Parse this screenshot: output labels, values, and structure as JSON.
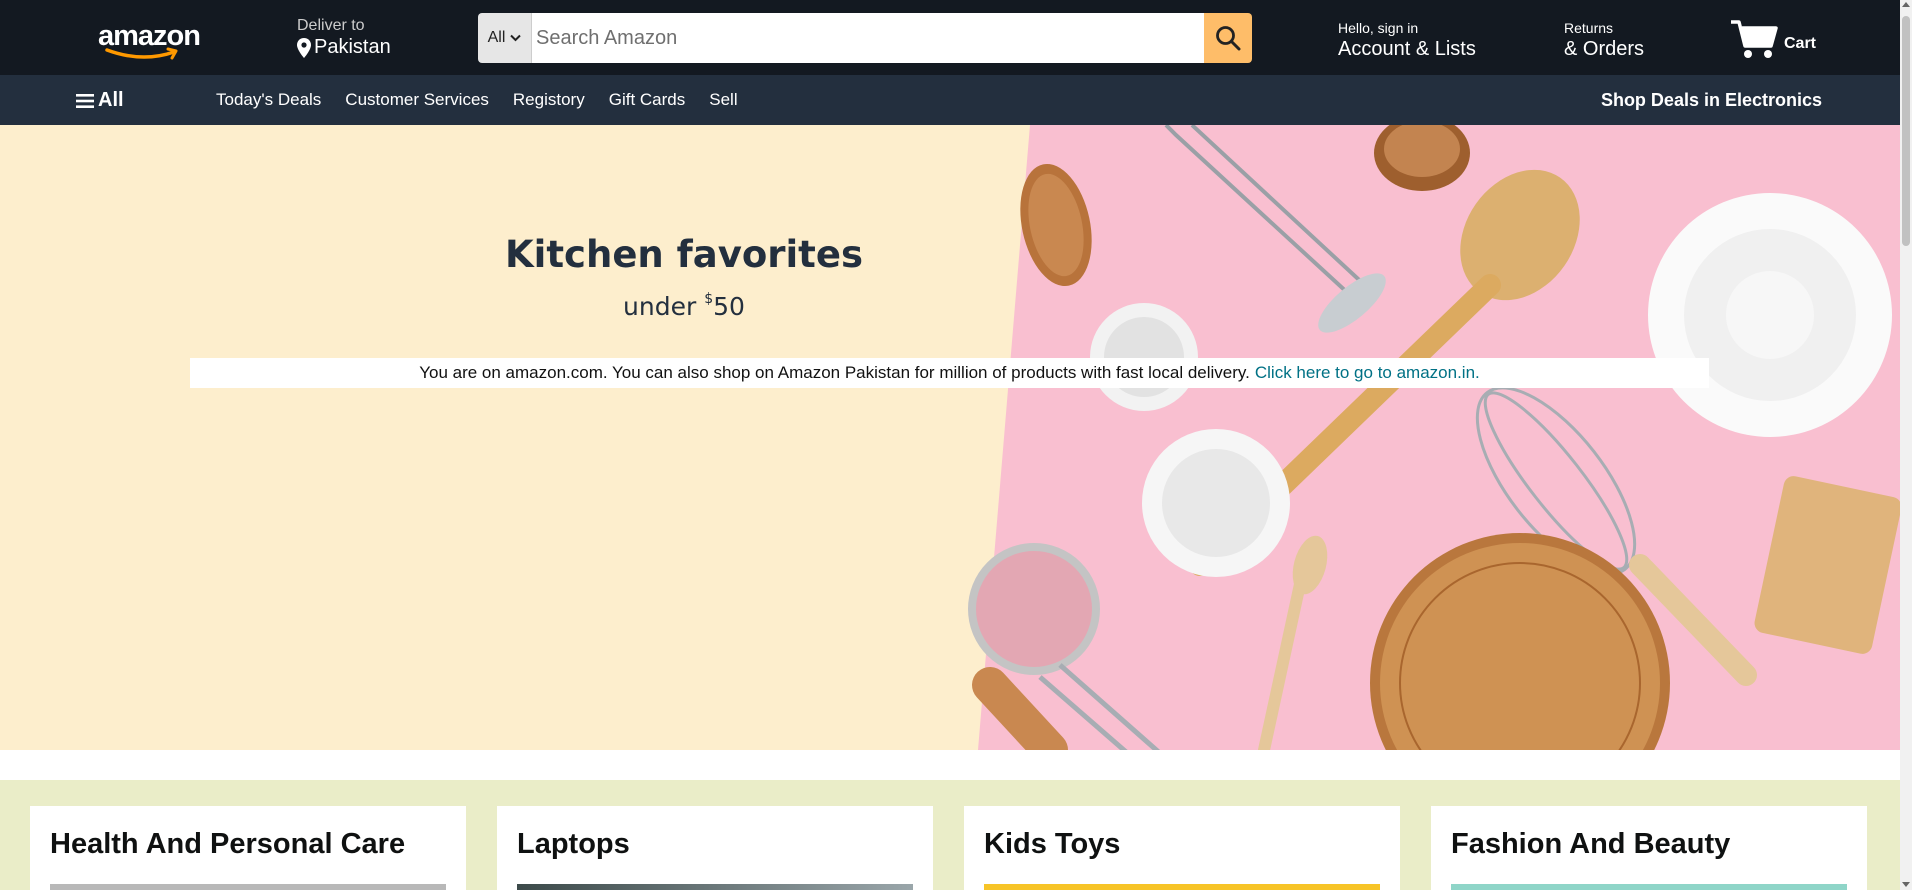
{
  "header": {
    "logo_text": "amazon",
    "deliver_label": "Deliver to",
    "deliver_location": "Pakistan",
    "search": {
      "category": "All",
      "placeholder": "Search Amazon",
      "value": ""
    },
    "account_line1": "Hello, sign in",
    "account_line2": "Account & Lists",
    "orders_line1": "Returns",
    "orders_line2": "& Orders",
    "cart_label": "Cart"
  },
  "subnav": {
    "all_label": "All",
    "links": [
      "Today's Deals",
      "Customer Services",
      "Registory",
      "Gift Cards",
      "Sell"
    ],
    "promo": "Shop Deals in Electronics"
  },
  "hero": {
    "title": "Kitchen favorites",
    "subtitle_prefix": "under ",
    "subtitle_currency": "$",
    "subtitle_amount": "50",
    "notice_text": "You are on amazon.com. You can also shop on Amazon Pakistan for million of products with fast local delivery.",
    "notice_link": "Click here to go to amazon.in."
  },
  "cards": [
    {
      "title": "Health And Personal Care"
    },
    {
      "title": "Laptops"
    },
    {
      "title": "Kids Toys"
    },
    {
      "title": "Fashion And Beauty"
    }
  ],
  "colors": {
    "header_bg": "#131921",
    "subnav_bg": "#232f3e",
    "search_button": "#febd69",
    "link": "#007185",
    "hero_left": "#fdeecd",
    "hero_right": "#f9bfd0",
    "cards_bg": "#eaedc8"
  },
  "icons": [
    "location-pin-icon",
    "chevron-down-icon",
    "search-icon",
    "cart-icon",
    "hamburger-menu-icon"
  ]
}
